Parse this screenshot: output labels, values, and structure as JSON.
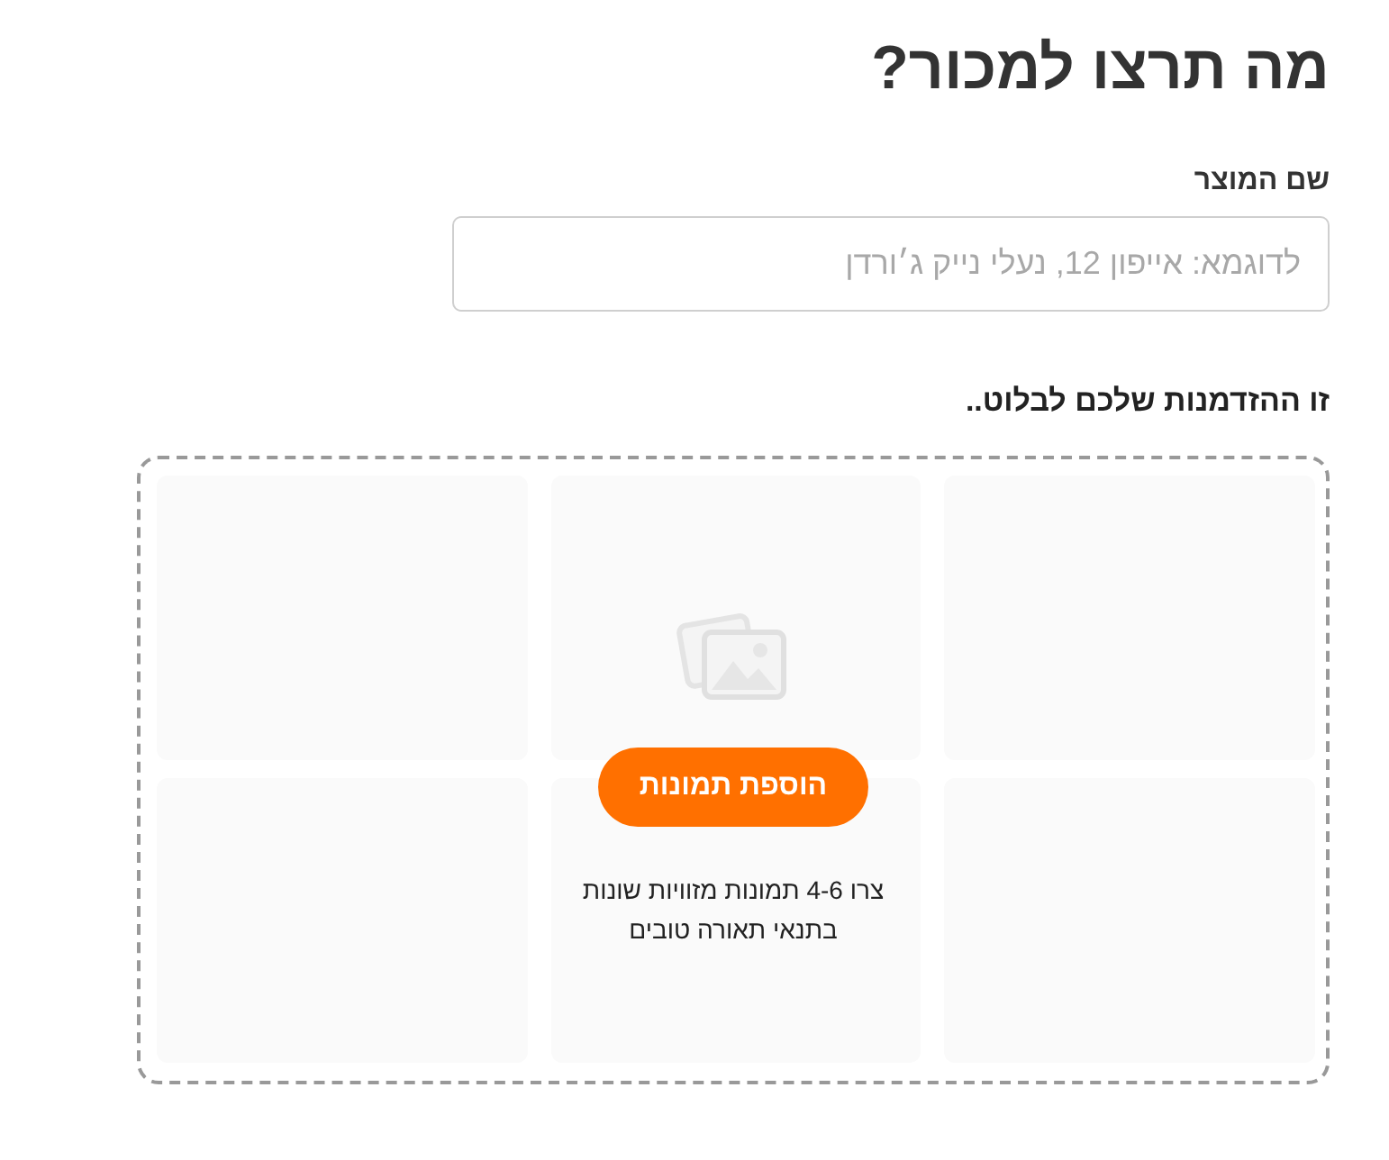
{
  "title": "מה תרצו למכור?",
  "product_name": {
    "label": "שם המוצר",
    "placeholder": "לדוגמא: אייפון 12, נעלי נייק ג׳ורדן"
  },
  "section_title": "זו ההזדמנות שלכם לבלוט..",
  "upload": {
    "button": "הוספת תמונות",
    "hint": "צרו 4-6 תמונות מזוויות שונות בתנאי תאורה טובים",
    "slots": [
      {
        "kind": "empty"
      },
      {
        "kind": "empty"
      },
      {
        "kind": "empty"
      },
      {
        "kind": "empty"
      },
      {
        "kind": "empty"
      },
      {
        "kind": "empty"
      }
    ]
  }
}
